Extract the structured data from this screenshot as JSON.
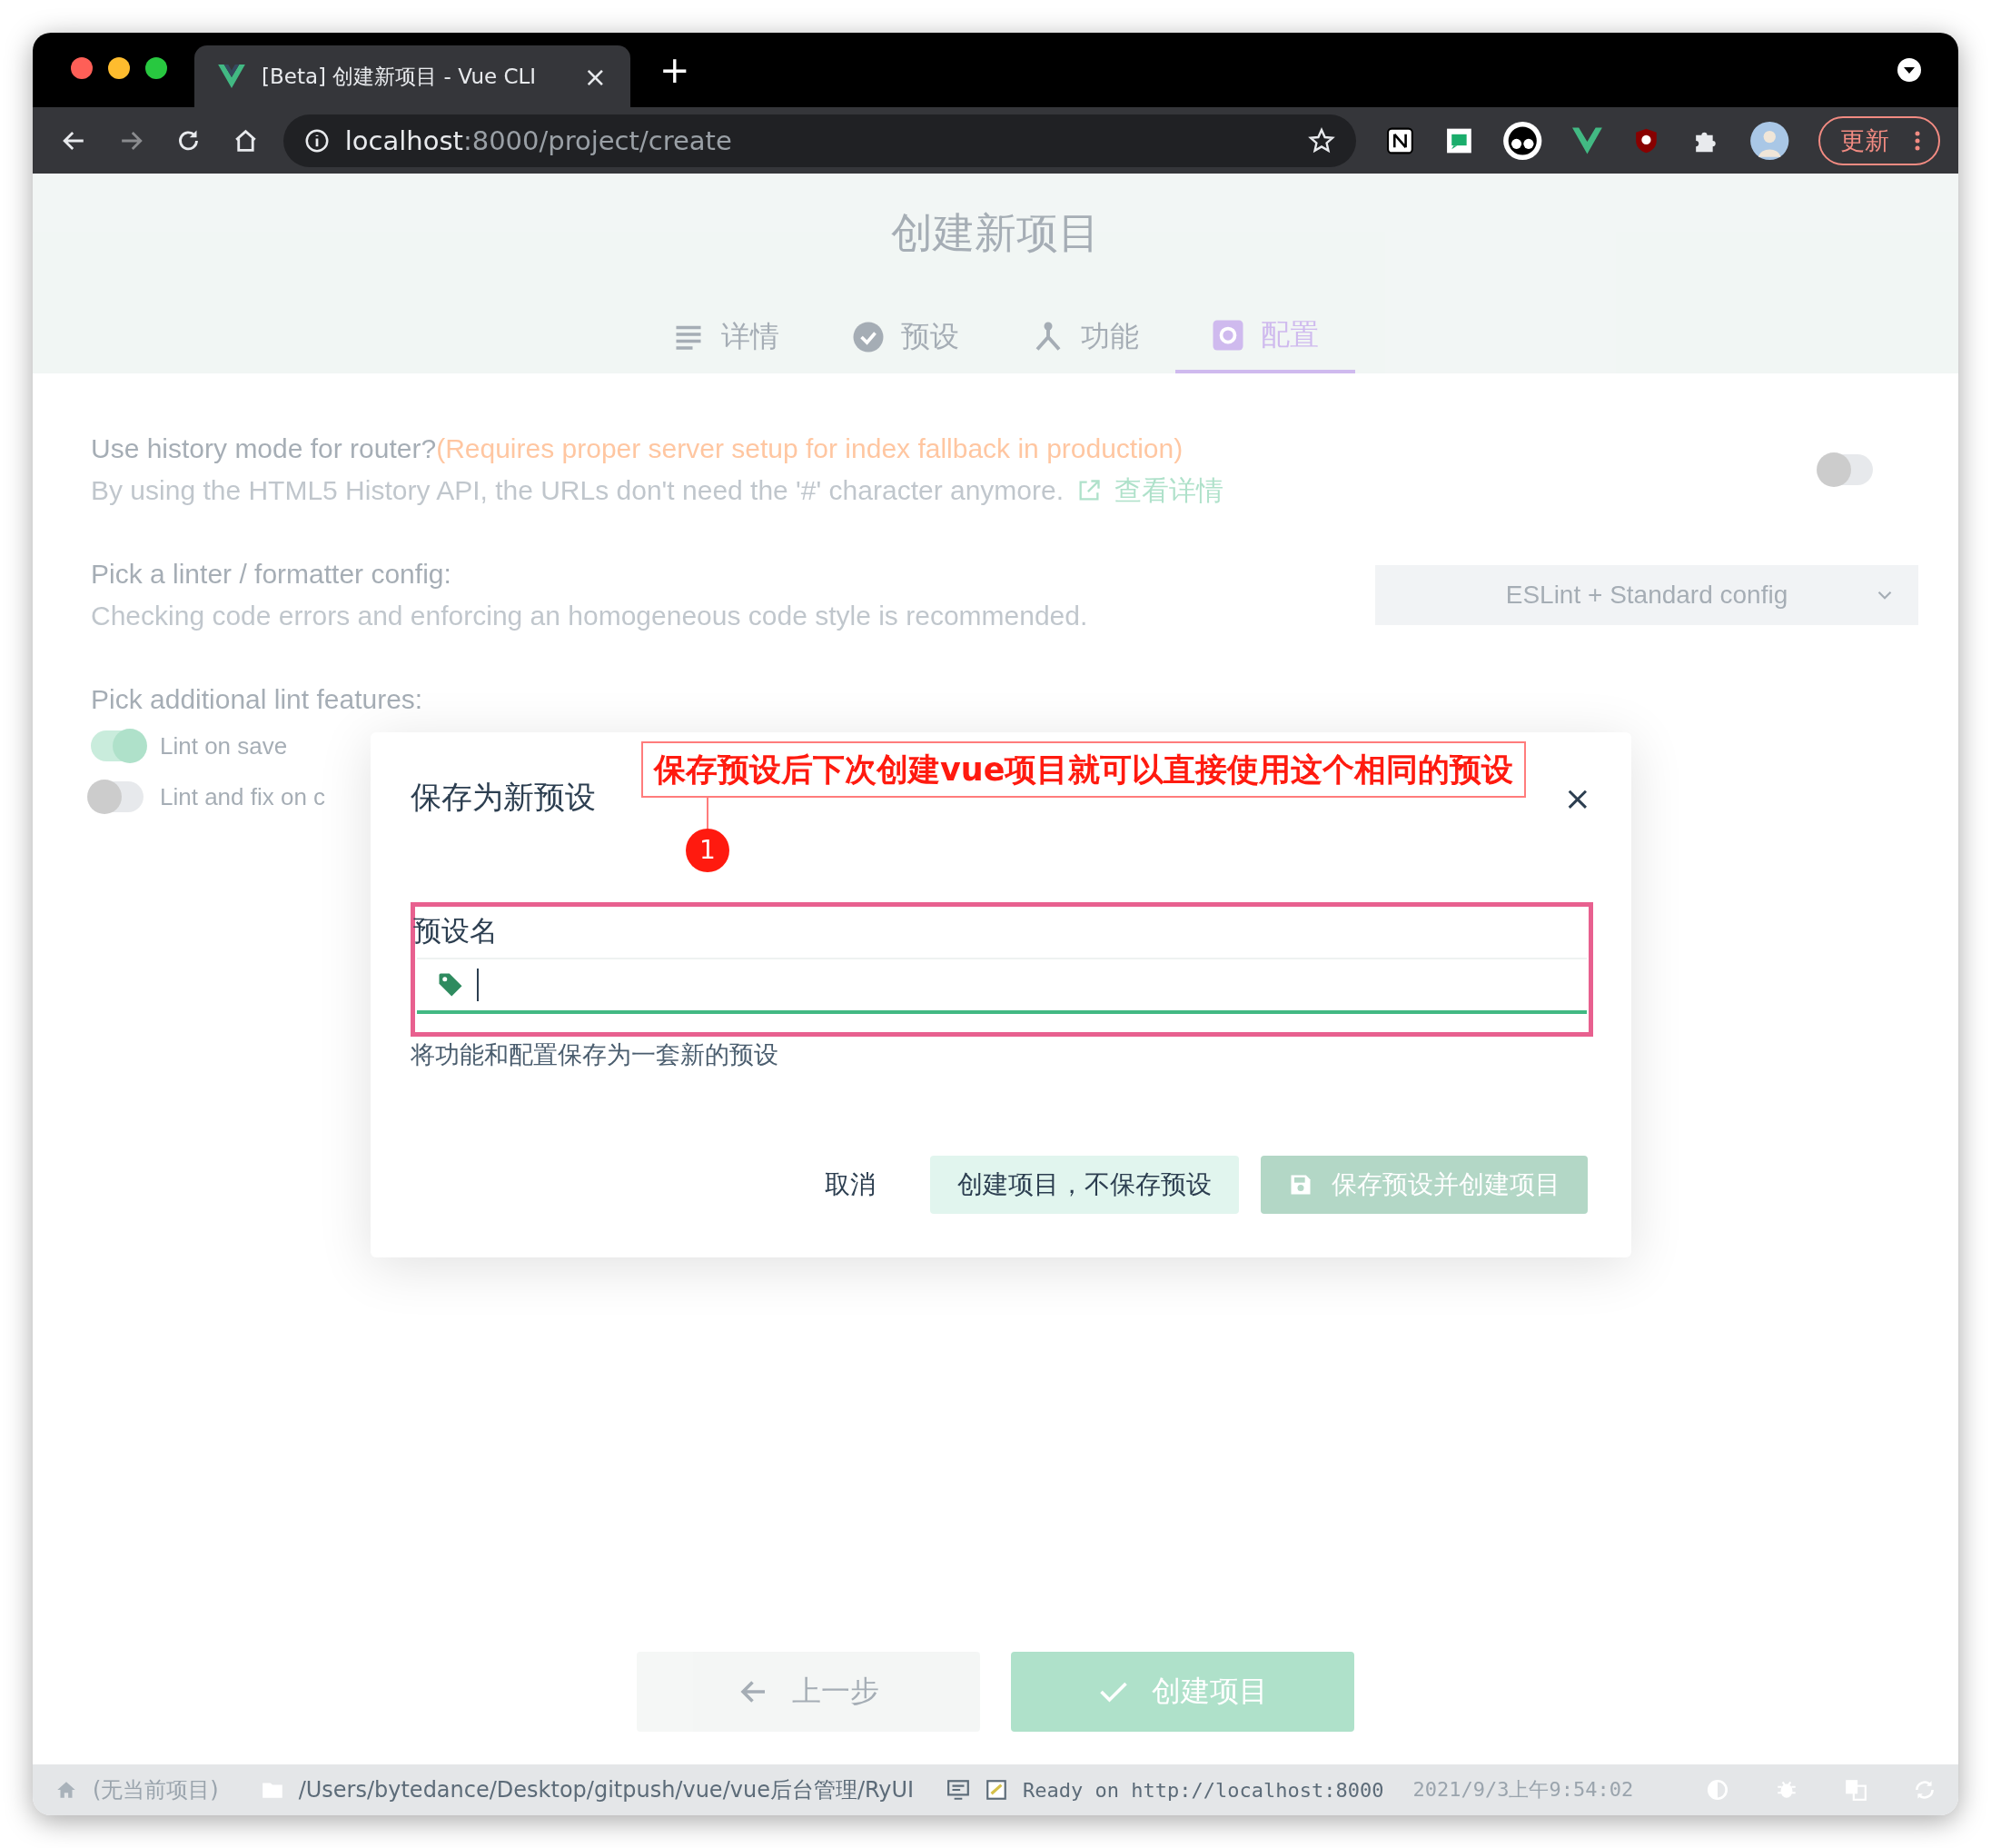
{
  "browser": {
    "tab": {
      "title": "[Beta] 创建新项目 - Vue CLI",
      "close": "×"
    },
    "new_tab": "+",
    "url": {
      "host": "localhost",
      "path": ":8000/project/create"
    },
    "update_button": "更新"
  },
  "page": {
    "title": "创建新项目",
    "steps": [
      {
        "label": "详情",
        "selected": false
      },
      {
        "label": "预设",
        "selected": false
      },
      {
        "label": "功能",
        "selected": false
      },
      {
        "label": "配置",
        "selected": true
      }
    ],
    "settings": [
      {
        "kind": "toggle",
        "title": "Use history mode for router?",
        "note": "(Requires proper server setup for index fallback in production)",
        "description": "By using the HTML5 History API, the URLs don't need the '#' character anymore.",
        "link": "查看详情",
        "on": false
      },
      {
        "kind": "select",
        "title": "Pick a linter / formatter config:",
        "description": "Checking code errors and enforcing an homogeneous code style is recommended.",
        "value": "ESLint + Standard config"
      }
    ],
    "lint_features": {
      "title": "Pick additional lint features:",
      "options": [
        {
          "label": "Lint on save",
          "on": true
        },
        {
          "label": "Lint and fix on c",
          "on": false
        }
      ]
    },
    "footer_buttons": [
      {
        "kind": "back",
        "label": "上一步"
      },
      {
        "kind": "primary",
        "label": "创建项目"
      }
    ]
  },
  "dialog": {
    "title": "保存为新预设",
    "close": "×",
    "field": {
      "label": "预设名",
      "hint": "将功能和配置保存为一套新的预设"
    },
    "buttons": [
      {
        "kind": "flat",
        "label": "取消",
        "disabled": false
      },
      {
        "kind": "secondary",
        "label": "创建项目，不保存预设",
        "disabled": false
      },
      {
        "kind": "primary",
        "label": "保存预设并创建项目",
        "disabled": true
      }
    ]
  },
  "annotation": {
    "text": "保存预设后下次创建vue项目就可以直接使用这个相同的预设",
    "number": "1"
  },
  "status_bar": {
    "project": "(无当前项目)",
    "path": "/Users/bytedance/Desktop/gitpush/vue/vue后台管理/RyUI",
    "log": "Ready on http://localhost:8000",
    "time": "2021/9/3上午9:54:02"
  }
}
